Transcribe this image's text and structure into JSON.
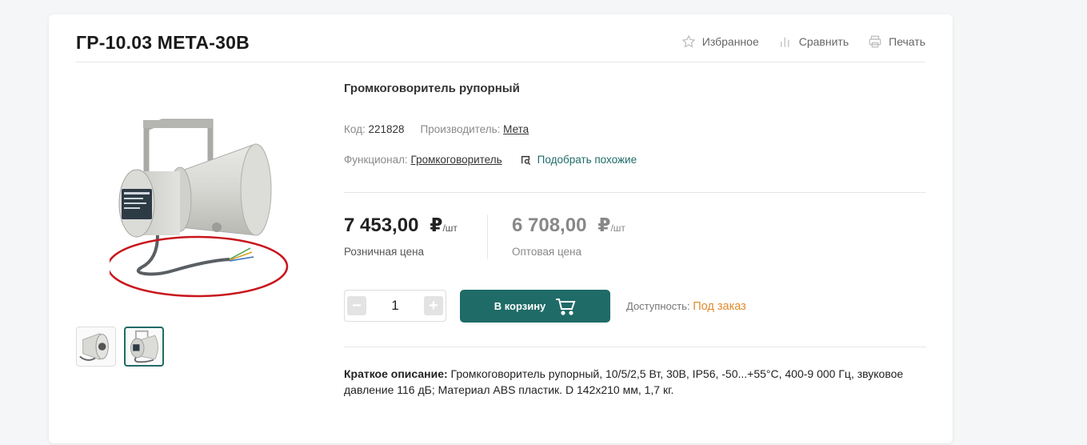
{
  "product": {
    "title": "ГР-10.03 МЕТА-30В",
    "subtitle": "Громкоговоритель рупорный"
  },
  "actions": {
    "favorite": "Избранное",
    "compare": "Сравнить",
    "print": "Печать"
  },
  "meta": {
    "code_label": "Код:",
    "code_value": "221828",
    "manufacturer_label": "Производитель:",
    "manufacturer_value": "Мета",
    "functional_label": "Функционал:",
    "functional_value": "Громкоговоритель",
    "similar_link": "Подобрать похожие"
  },
  "prices": {
    "retail_value": "7 453,00",
    "wholesale_value": "6 708,00",
    "currency": "₽",
    "unit": "/шт",
    "retail_label": "Розничная цена",
    "wholesale_label": "Оптовая цена"
  },
  "order": {
    "quantity": "1",
    "minus": "−",
    "plus": "+",
    "cart_button": "В корзину",
    "availability_label": "Доступность:",
    "availability_status": "Под заказ"
  },
  "description": {
    "label": "Краткое описание:",
    "text": " Громкоговоритель рупорный, 10/5/2,5 Вт, 30В, IP56, -50...+55°С, 400-9 000 Гц, звуковое давление 116 дБ; Материал ABS пластик. D 142х210 мм, 1,7 кг."
  },
  "colors": {
    "accent": "#1f6b67",
    "availability": "#e08a2c",
    "annotation": "#c8161d"
  },
  "gallery": {
    "thumbnails": 2,
    "active_index": 1
  }
}
